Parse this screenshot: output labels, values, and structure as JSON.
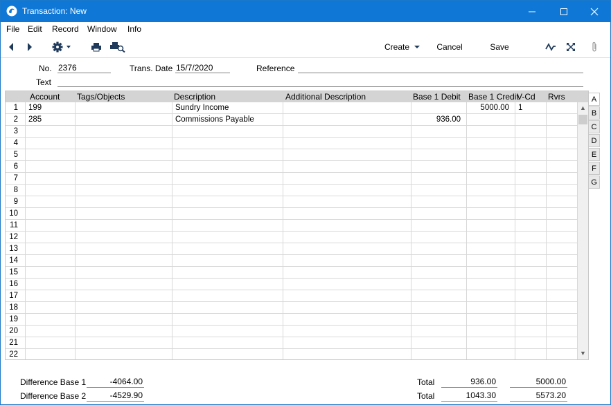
{
  "window": {
    "title": "Transaction: New"
  },
  "menu": [
    "File",
    "Edit",
    "Record",
    "Window",
    "Info"
  ],
  "toolbar": {
    "create_label": "Create",
    "cancel_label": "Cancel",
    "save_label": "Save"
  },
  "header": {
    "no_label": "No.",
    "no_value": "2376",
    "date_label": "Trans. Date",
    "date_value": "15/7/2020",
    "reference_label": "Reference",
    "reference_value": "",
    "text_label": "Text",
    "text_value": ""
  },
  "grid": {
    "columns": [
      "Account",
      "Tags/Objects",
      "Description",
      "Additional Description",
      "Base 1 Debit",
      "Base 1 Credit",
      "V-Cd",
      "Rvrs"
    ],
    "rows": [
      {
        "n": "1",
        "account": "199",
        "tags": "",
        "desc": "Sundry Income",
        "adddesc": "",
        "debit": "",
        "credit": "5000.00",
        "vcd": "1",
        "rvrs": ""
      },
      {
        "n": "2",
        "account": "285",
        "tags": "",
        "desc": "Commissions Payable",
        "adddesc": "",
        "debit": "936.00",
        "credit": "",
        "vcd": "",
        "rvrs": ""
      },
      {
        "n": "3"
      },
      {
        "n": "4"
      },
      {
        "n": "5"
      },
      {
        "n": "6"
      },
      {
        "n": "7"
      },
      {
        "n": "8"
      },
      {
        "n": "9"
      },
      {
        "n": "10"
      },
      {
        "n": "11"
      },
      {
        "n": "12"
      },
      {
        "n": "13"
      },
      {
        "n": "14"
      },
      {
        "n": "15"
      },
      {
        "n": "16"
      },
      {
        "n": "17"
      },
      {
        "n": "18"
      },
      {
        "n": "19"
      },
      {
        "n": "20"
      },
      {
        "n": "21"
      },
      {
        "n": "22"
      }
    ]
  },
  "side_tabs": [
    "A",
    "B",
    "C",
    "D",
    "E",
    "F",
    "G"
  ],
  "footer": {
    "diff1_label": "Difference Base 1",
    "diff1_value": "-4064.00",
    "diff2_label": "Difference Base 2",
    "diff2_value": "-4529.90",
    "total1_label": "Total",
    "total1_debit": "936.00",
    "total1_credit": "5000.00",
    "total2_label": "Total",
    "total2_debit": "1043.30",
    "total2_credit": "5573.20"
  },
  "colors": {
    "titlebar": "#0f78d7",
    "grid_header": "#d4d4d4"
  }
}
